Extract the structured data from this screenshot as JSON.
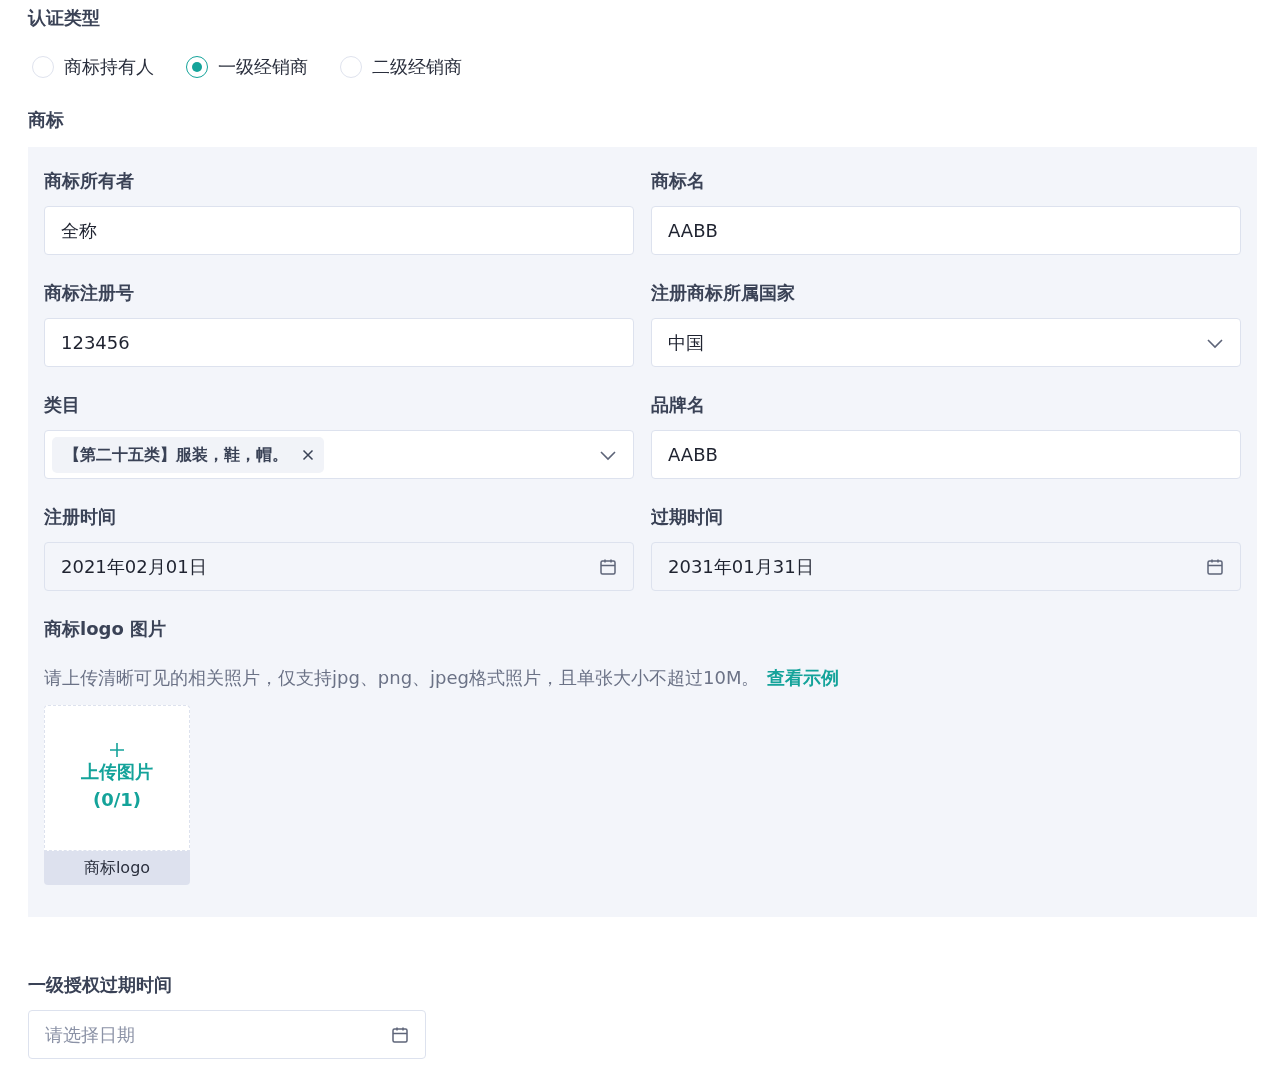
{
  "cert_type": {
    "label": "认证类型",
    "options": [
      {
        "label": "商标持有人",
        "selected": false
      },
      {
        "label": "一级经销商",
        "selected": true
      },
      {
        "label": "二级经销商",
        "selected": false
      }
    ]
  },
  "trademark": {
    "heading": "商标",
    "fields": [
      {
        "kind": "text",
        "label": "商标所有者",
        "value": "全称"
      },
      {
        "kind": "text",
        "label": "商标名",
        "value": "AABB"
      },
      {
        "kind": "text",
        "label": "商标注册号",
        "value": "123456"
      },
      {
        "kind": "select",
        "label": "注册商标所属国家",
        "value": "中国"
      },
      {
        "kind": "tags",
        "label": "类目",
        "tags": [
          "【第二十五类】服装，鞋，帽。"
        ]
      },
      {
        "kind": "text",
        "label": "品牌名",
        "value": "AABB"
      },
      {
        "kind": "date",
        "label": "注册时间",
        "value": "2021年02月01日",
        "disabled": true
      },
      {
        "kind": "date",
        "label": "过期时间",
        "value": "2031年01月31日",
        "disabled": true
      }
    ],
    "logo": {
      "label": "商标logo 图片",
      "hint": "请上传清晰可见的相关照片，仅支持jpg、png、jpeg格式照片，且单张大小不超过10M。",
      "example_link": "查看示例",
      "upload_text": "上传图片",
      "upload_count": "(0/1)",
      "caption": "商标logo"
    }
  },
  "auth_expiry": {
    "label": "一级授权过期时间",
    "kind": "date",
    "placeholder": "请选择日期",
    "disabled": false
  }
}
